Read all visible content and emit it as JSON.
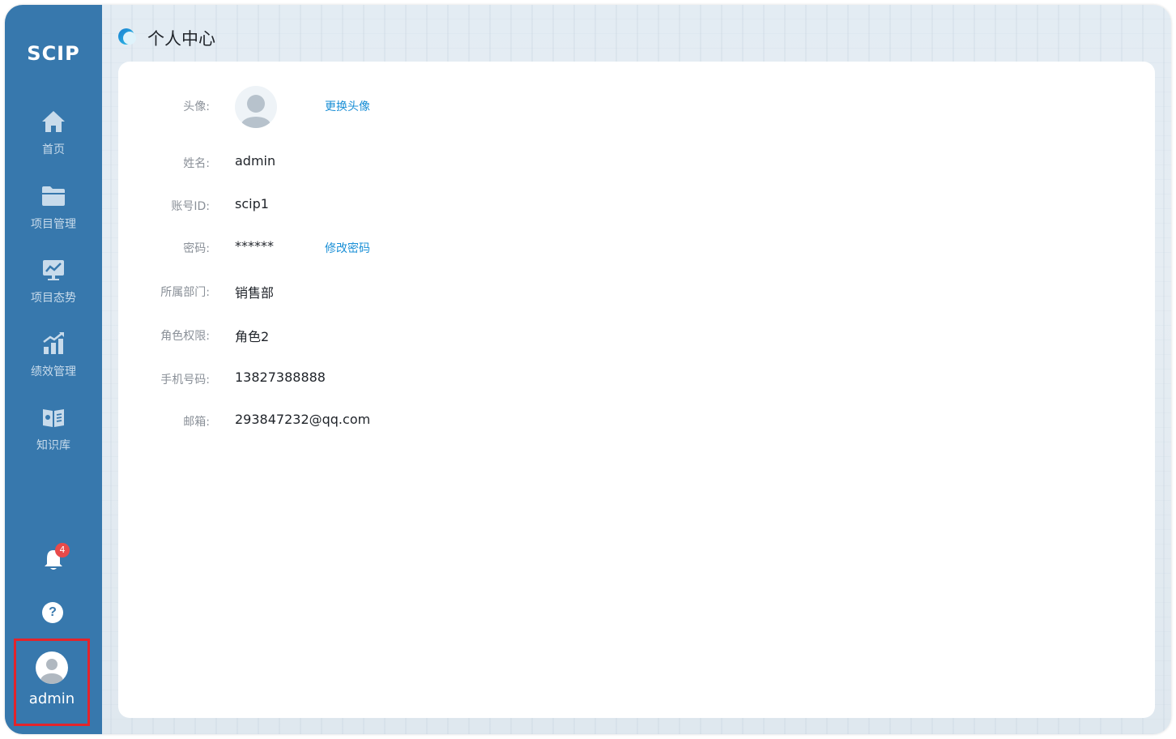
{
  "sidebar": {
    "logo": "SCIP",
    "items": [
      {
        "label": "首页",
        "icon": "home-icon"
      },
      {
        "label": "项目管理",
        "icon": "folder-icon"
      },
      {
        "label": "项目态势",
        "icon": "trend-board-icon"
      },
      {
        "label": "绩效管理",
        "icon": "bar-chart-icon"
      },
      {
        "label": "知识库",
        "icon": "book-icon"
      }
    ],
    "notification_count": "4",
    "help_symbol": "?",
    "user_name": "admin"
  },
  "header": {
    "title": "个人中心"
  },
  "profile": {
    "avatar_label": "头像:",
    "change_avatar": "更换头像",
    "name_label": "姓名:",
    "name": "admin",
    "account_label": "账号ID:",
    "account": "scip1",
    "password_label": "密码:",
    "password": "******",
    "change_password": "修改密码",
    "dept_label": "所属部门:",
    "dept": "销售部",
    "role_label": "角色权限:",
    "role": "角色2",
    "phone_label": "手机号码:",
    "phone": "13827388888",
    "email_label": "邮箱:",
    "email": "293847232@qq.com"
  },
  "colors": {
    "sidebar": "#3778ad",
    "link": "#1a8fd6",
    "highlight_border": "#e3242b",
    "badge": "#e84a4a"
  }
}
